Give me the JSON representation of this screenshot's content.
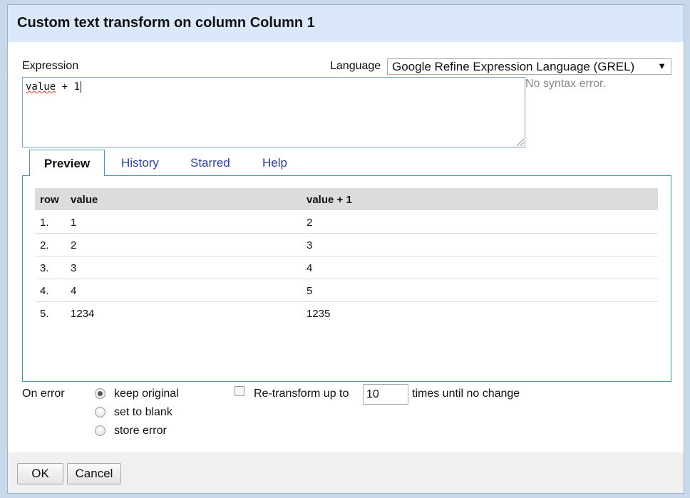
{
  "dialog": {
    "title": "Custom text transform on column Column 1"
  },
  "expression": {
    "label": "Expression",
    "text_var": "value",
    "text_rest": " + 1",
    "status": "No syntax error."
  },
  "language": {
    "label": "Language",
    "selected": "Google Refine Expression Language (GREL)",
    "arrow": "▼"
  },
  "tabs": [
    {
      "label": "Preview",
      "active": true
    },
    {
      "label": "History",
      "active": false
    },
    {
      "label": "Starred",
      "active": false
    },
    {
      "label": "Help",
      "active": false
    }
  ],
  "preview": {
    "headers": [
      "row",
      "value",
      "value + 1"
    ],
    "rows": [
      [
        "1.",
        "1",
        "2"
      ],
      [
        "2.",
        "2",
        "3"
      ],
      [
        "3.",
        "3",
        "4"
      ],
      [
        "4.",
        "4",
        "5"
      ],
      [
        "5.",
        "1234",
        "1235"
      ]
    ]
  },
  "on_error": {
    "label": "On error",
    "options": [
      {
        "label": "keep original",
        "checked": true
      },
      {
        "label": "set to blank",
        "checked": false
      },
      {
        "label": "store error",
        "checked": false
      }
    ]
  },
  "retransform": {
    "checked": false,
    "label": "Re-transform up to",
    "value": "10",
    "suffix": "times until no change"
  },
  "buttons": {
    "ok": "OK",
    "cancel": "Cancel"
  }
}
